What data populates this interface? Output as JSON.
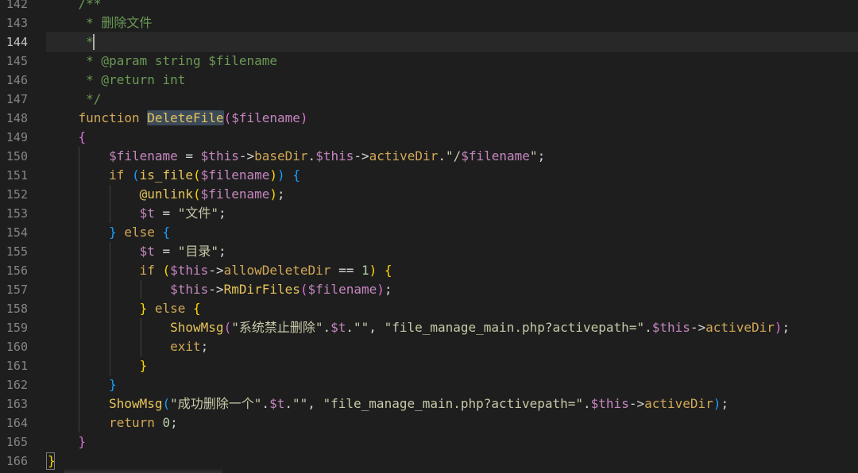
{
  "editor": {
    "current_line": 144,
    "lines": [
      {
        "n": 142,
        "tokens": [
          [
            "    /**",
            "t-comment"
          ]
        ]
      },
      {
        "n": 143,
        "tokens": [
          [
            "     * 删除文件",
            "t-comment"
          ]
        ]
      },
      {
        "n": 144,
        "tokens": [
          [
            "     *",
            "t-comment"
          ]
        ]
      },
      {
        "n": 145,
        "tokens": [
          [
            "     * @param string $filename",
            "t-comment"
          ]
        ]
      },
      {
        "n": 146,
        "tokens": [
          [
            "     * @return int",
            "t-comment"
          ]
        ]
      },
      {
        "n": 147,
        "tokens": [
          [
            "     */",
            "t-comment"
          ]
        ]
      },
      {
        "n": 148,
        "tokens": [
          [
            "    ",
            "t-plain"
          ],
          [
            "function",
            "t-kw"
          ],
          [
            " ",
            "t-plain"
          ],
          [
            "DeleteFile",
            "t-fn-hl"
          ],
          [
            "(",
            "t-b2"
          ],
          [
            "$filename",
            "t-var"
          ],
          [
            ")",
            "t-b2"
          ]
        ]
      },
      {
        "n": 149,
        "tokens": [
          [
            "    ",
            "t-plain"
          ],
          [
            "{",
            "t-b2"
          ]
        ]
      },
      {
        "n": 150,
        "tokens": [
          [
            "        ",
            "t-plain"
          ],
          [
            "$filename",
            "t-var"
          ],
          [
            " = ",
            "t-plain"
          ],
          [
            "$this",
            "t-var"
          ],
          [
            "->",
            "t-plain"
          ],
          [
            "baseDir",
            "t-kw"
          ],
          [
            ".",
            "t-plain"
          ],
          [
            "$this",
            "t-var"
          ],
          [
            "->",
            "t-plain"
          ],
          [
            "activeDir",
            "t-kw"
          ],
          [
            ".",
            "t-plain"
          ],
          [
            "\"/",
            "t-str"
          ],
          [
            "$filename",
            "t-var"
          ],
          [
            "\"",
            "t-str"
          ],
          [
            ";",
            "t-plain"
          ]
        ]
      },
      {
        "n": 151,
        "tokens": [
          [
            "        ",
            "t-plain"
          ],
          [
            "if",
            "t-kw"
          ],
          [
            " ",
            "t-plain"
          ],
          [
            "(",
            "t-b3"
          ],
          [
            "is_file",
            "t-fn"
          ],
          [
            "(",
            "t-b1"
          ],
          [
            "$filename",
            "t-var"
          ],
          [
            ")",
            "t-b1"
          ],
          [
            ")",
            "t-b3"
          ],
          [
            " ",
            "t-plain"
          ],
          [
            "{",
            "t-b3"
          ]
        ]
      },
      {
        "n": 152,
        "tokens": [
          [
            "            ",
            "t-plain"
          ],
          [
            "@unlink",
            "t-fn"
          ],
          [
            "(",
            "t-b1"
          ],
          [
            "$filename",
            "t-var"
          ],
          [
            ")",
            "t-b1"
          ],
          [
            ";",
            "t-plain"
          ]
        ]
      },
      {
        "n": 153,
        "tokens": [
          [
            "            ",
            "t-plain"
          ],
          [
            "$t",
            "t-var"
          ],
          [
            " = ",
            "t-plain"
          ],
          [
            "\"文件\"",
            "t-str"
          ],
          [
            ";",
            "t-plain"
          ]
        ]
      },
      {
        "n": 154,
        "tokens": [
          [
            "        ",
            "t-plain"
          ],
          [
            "}",
            "t-b3"
          ],
          [
            " ",
            "t-plain"
          ],
          [
            "else",
            "t-kw"
          ],
          [
            " ",
            "t-plain"
          ],
          [
            "{",
            "t-b3"
          ]
        ]
      },
      {
        "n": 155,
        "tokens": [
          [
            "            ",
            "t-plain"
          ],
          [
            "$t",
            "t-var"
          ],
          [
            " = ",
            "t-plain"
          ],
          [
            "\"目录\"",
            "t-str"
          ],
          [
            ";",
            "t-plain"
          ]
        ]
      },
      {
        "n": 156,
        "tokens": [
          [
            "            ",
            "t-plain"
          ],
          [
            "if",
            "t-kw"
          ],
          [
            " ",
            "t-plain"
          ],
          [
            "(",
            "t-b1"
          ],
          [
            "$this",
            "t-var"
          ],
          [
            "->",
            "t-plain"
          ],
          [
            "allowDeleteDir",
            "t-kw"
          ],
          [
            " == ",
            "t-plain"
          ],
          [
            "1",
            "t-num"
          ],
          [
            ")",
            "t-b1"
          ],
          [
            " ",
            "t-plain"
          ],
          [
            "{",
            "t-b1"
          ]
        ]
      },
      {
        "n": 157,
        "tokens": [
          [
            "                ",
            "t-plain"
          ],
          [
            "$this",
            "t-var"
          ],
          [
            "->",
            "t-plain"
          ],
          [
            "RmDirFiles",
            "t-fn"
          ],
          [
            "(",
            "t-b2"
          ],
          [
            "$filename",
            "t-var"
          ],
          [
            ")",
            "t-b2"
          ],
          [
            ";",
            "t-plain"
          ]
        ]
      },
      {
        "n": 158,
        "tokens": [
          [
            "            ",
            "t-plain"
          ],
          [
            "}",
            "t-b1"
          ],
          [
            " ",
            "t-plain"
          ],
          [
            "else",
            "t-kw"
          ],
          [
            " ",
            "t-plain"
          ],
          [
            "{",
            "t-b1"
          ]
        ]
      },
      {
        "n": 159,
        "tokens": [
          [
            "                ",
            "t-plain"
          ],
          [
            "ShowMsg",
            "t-fn"
          ],
          [
            "(",
            "t-b2"
          ],
          [
            "\"系统禁止删除\"",
            "t-str"
          ],
          [
            ".",
            "t-plain"
          ],
          [
            "$t",
            "t-var"
          ],
          [
            ".",
            "t-plain"
          ],
          [
            "\"\"",
            "t-str"
          ],
          [
            ", ",
            "t-plain"
          ],
          [
            "\"file_manage_main.php?activepath=\"",
            "t-str"
          ],
          [
            ".",
            "t-plain"
          ],
          [
            "$this",
            "t-var"
          ],
          [
            "->",
            "t-plain"
          ],
          [
            "activeDir",
            "t-kw"
          ],
          [
            ")",
            "t-b2"
          ],
          [
            ";",
            "t-plain"
          ]
        ]
      },
      {
        "n": 160,
        "tokens": [
          [
            "                ",
            "t-plain"
          ],
          [
            "exit",
            "t-kw"
          ],
          [
            ";",
            "t-plain"
          ]
        ]
      },
      {
        "n": 161,
        "tokens": [
          [
            "            ",
            "t-plain"
          ],
          [
            "}",
            "t-b1"
          ]
        ]
      },
      {
        "n": 162,
        "tokens": [
          [
            "        ",
            "t-plain"
          ],
          [
            "}",
            "t-b3"
          ]
        ]
      },
      {
        "n": 163,
        "tokens": [
          [
            "        ",
            "t-plain"
          ],
          [
            "ShowMsg",
            "t-fn"
          ],
          [
            "(",
            "t-b3"
          ],
          [
            "\"成功删除一个\"",
            "t-str"
          ],
          [
            ".",
            "t-plain"
          ],
          [
            "$t",
            "t-var"
          ],
          [
            ".",
            "t-plain"
          ],
          [
            "\"\"",
            "t-str"
          ],
          [
            ", ",
            "t-plain"
          ],
          [
            "\"file_manage_main.php?activepath=\"",
            "t-str"
          ],
          [
            ".",
            "t-plain"
          ],
          [
            "$this",
            "t-var"
          ],
          [
            "->",
            "t-plain"
          ],
          [
            "activeDir",
            "t-kw"
          ],
          [
            ")",
            "t-b3"
          ],
          [
            ";",
            "t-plain"
          ]
        ]
      },
      {
        "n": 164,
        "tokens": [
          [
            "        ",
            "t-plain"
          ],
          [
            "return",
            "t-kw"
          ],
          [
            " ",
            "t-plain"
          ],
          [
            "0",
            "t-num"
          ],
          [
            ";",
            "t-plain"
          ]
        ]
      },
      {
        "n": 165,
        "tokens": [
          [
            "    ",
            "t-plain"
          ],
          [
            "}",
            "t-b2"
          ]
        ]
      },
      {
        "n": 166,
        "tokens": [
          [
            "}",
            "t-b1"
          ]
        ]
      }
    ]
  }
}
